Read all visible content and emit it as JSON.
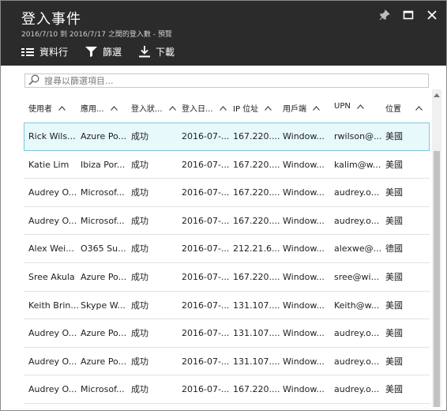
{
  "header": {
    "title": "登入事件",
    "subtitle": "2016/7/10 到 2016/7/17 之間的登入數 - 預覽"
  },
  "toolbar": {
    "columns_label": "資料行",
    "filter_label": "篩選",
    "download_label": "下載"
  },
  "search": {
    "placeholder": "搜尋以篩選項目..."
  },
  "table": {
    "columns": [
      "使用者",
      "應用...",
      "登入狀...",
      "登入日...",
      "IP 位址",
      "用戶端",
      "UPN",
      "位置"
    ],
    "rows": [
      [
        "Rick Wils...",
        "Azure Po...",
        "成功",
        "2016-07-...",
        "167.220....",
        "Window...",
        "rwilson@...",
        "美國"
      ],
      [
        "Katie Lim",
        "Ibiza Por...",
        "成功",
        "2016-07-...",
        "167.220....",
        "Window...",
        "kalim@w...",
        "美國"
      ],
      [
        "Audrey O...",
        "Microsof...",
        "成功",
        "2016-07-...",
        "167.220....",
        "Window...",
        "audrey.o...",
        "美國"
      ],
      [
        "Audrey O...",
        "Microsof...",
        "成功",
        "2016-07-...",
        "167.220....",
        "Window...",
        "audrey.o...",
        "美國"
      ],
      [
        "Alex Wei...",
        "O365 Su...",
        "成功",
        "2016-07-...",
        "212.21.6...",
        "Window...",
        "alexwe@...",
        "德國"
      ],
      [
        "Sree Akula",
        "Azure Po...",
        "成功",
        "2016-07-...",
        "167.220....",
        "Window...",
        "sree@wi...",
        "美國"
      ],
      [
        "Keith Brin...",
        "Skype W...",
        "成功",
        "2016-07-...",
        "131.107....",
        "Window...",
        "Keith@w...",
        "美國"
      ],
      [
        "Audrey O...",
        "Azure Po...",
        "成功",
        "2016-07-...",
        "131.107....",
        "Window...",
        "audrey.o...",
        "美國"
      ],
      [
        "Audrey O...",
        "Azure Po...",
        "成功",
        "2016-07-...",
        "131.107....",
        "Window...",
        "audrey.o...",
        "美國"
      ],
      [
        "Audrey O...",
        "Microsof...",
        "成功",
        "2016-07-...",
        "167.220....",
        "Window...",
        "audrey.o...",
        "美國"
      ]
    ]
  },
  "colors": {
    "header_bg": "#2b2b2b",
    "selected_row_bg": "#e7f9fb",
    "selected_row_border": "#7cc6dd"
  },
  "icons": {
    "pin": "pin-icon",
    "maximize": "maximize-icon",
    "close": "close-icon",
    "columns": "list-columns-icon",
    "filter": "filter-icon",
    "download": "download-icon",
    "search": "search-icon",
    "sort": "caret-up-icon"
  }
}
